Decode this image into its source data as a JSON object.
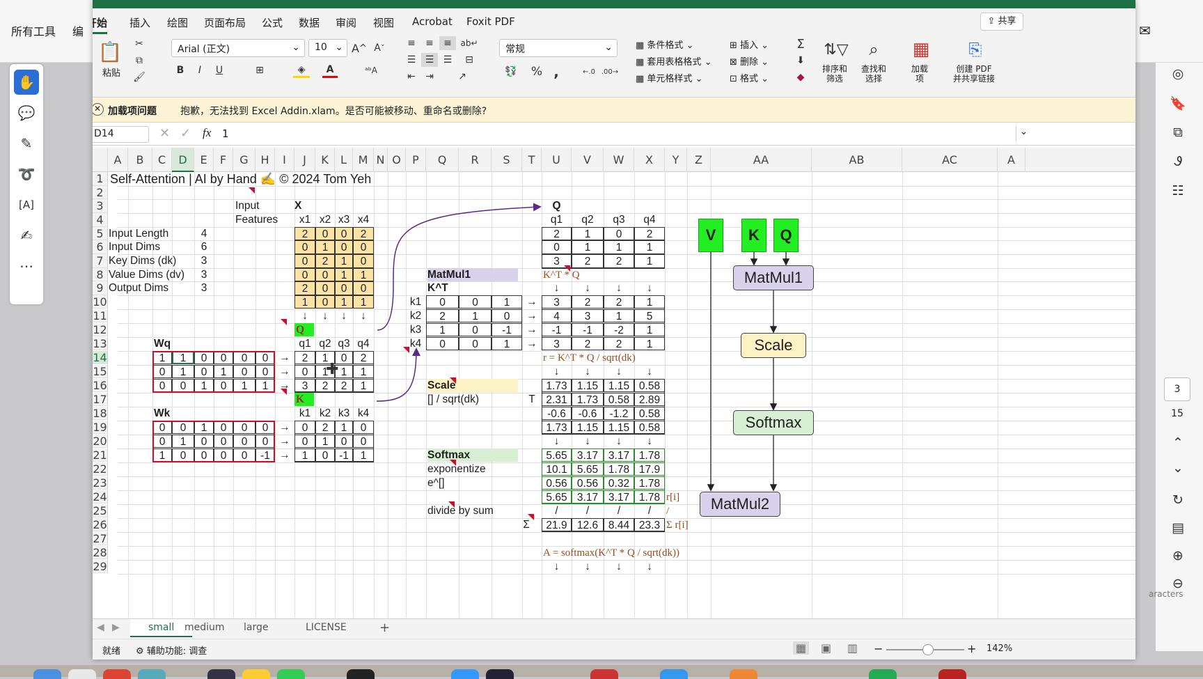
{
  "pdf": {
    "all_tools": "所有工具",
    "edit": "编",
    "page_current": "3",
    "page_total": "15",
    "chars_text": "aracters"
  },
  "tabs": [
    "开始",
    "插入",
    "绘图",
    "页面布局",
    "公式",
    "数据",
    "审阅",
    "视图",
    "Acrobat",
    "Foxit PDF"
  ],
  "share": "共享",
  "ribbon": {
    "paste": "粘贴",
    "font": "Arial (正文)",
    "size": "10",
    "bold": "B",
    "italic": "I",
    "underline": "U",
    "num_format": "常规",
    "cond_fmt": "条件格式",
    "table_fmt": "套用表格格式",
    "cell_style": "单元格样式",
    "insert": "插入",
    "delete": "删除",
    "format": "格式",
    "sort1": "排序和",
    "sort2": "筛选",
    "find1": "查找和",
    "find2": "选择",
    "addins1": "加载",
    "addins2": "项",
    "pdf1": "创建 PDF",
    "pdf2": "并共享链接",
    "percent": "%",
    "comma": ","
  },
  "msg": {
    "title": "加载项问题",
    "text": "抱歉，无法找到 Excel Addin.xlam。是否可能被移动、重命名或删除?"
  },
  "formula": {
    "cell": "D14",
    "fx": "fx",
    "value": "1"
  },
  "cols": [
    "A",
    "B",
    "C",
    "D",
    "E",
    "F",
    "G",
    "H",
    "I",
    "J",
    "K",
    "L",
    "M",
    "N",
    "O",
    "P",
    "Q",
    "R",
    "S",
    "T",
    "U",
    "V",
    "W",
    "X",
    "Y",
    "Z",
    "AA",
    "AB",
    "AC",
    "A"
  ],
  "rows": [
    "1",
    "2",
    "3",
    "4",
    "5",
    "6",
    "7",
    "8",
    "9",
    "10",
    "11",
    "12",
    "13",
    "14",
    "15",
    "16",
    "17",
    "18",
    "19",
    "20",
    "21",
    "22",
    "23",
    "24",
    "25",
    "26",
    "27",
    "28",
    "29"
  ],
  "sheet": {
    "title": "Self-Attention | AI by Hand ✍ © 2024 Tom Yeh",
    "params": [
      [
        "Input Length",
        "4"
      ],
      [
        "Input Dims",
        "6"
      ],
      [
        "Key Dims (dk)",
        "3"
      ],
      [
        "Value Dims (dv)",
        "3"
      ],
      [
        "Output Dims",
        "3"
      ]
    ],
    "input_label1": "Input",
    "input_label2": "Features",
    "x_label": "X",
    "x_heads": [
      "x1",
      "x2",
      "x3",
      "x4"
    ],
    "x": [
      [
        "2",
        "0",
        "0",
        "2"
      ],
      [
        "0",
        "1",
        "0",
        "0"
      ],
      [
        "0",
        "2",
        "1",
        "0"
      ],
      [
        "0",
        "0",
        "1",
        "1"
      ],
      [
        "2",
        "0",
        "0",
        "0"
      ],
      [
        "1",
        "0",
        "1",
        "1"
      ]
    ],
    "arrow_down": "↓",
    "arrow_right": "→",
    "q_tag": "Q",
    "k_tag": "K",
    "wq_label": "Wq",
    "wk_label": "Wk",
    "wq": [
      [
        "1",
        "1",
        "0",
        "0",
        "0",
        "0"
      ],
      [
        "0",
        "1",
        "0",
        "1",
        "0",
        "0"
      ],
      [
        "0",
        "0",
        "1",
        "0",
        "1",
        "1"
      ]
    ],
    "wk": [
      [
        "0",
        "0",
        "1",
        "0",
        "0",
        "0"
      ],
      [
        "0",
        "1",
        "0",
        "0",
        "0",
        "0"
      ],
      [
        "1",
        "0",
        "0",
        "0",
        "0",
        "-1"
      ]
    ],
    "q_heads": [
      "q1",
      "q2",
      "q3",
      "q4"
    ],
    "k_heads": [
      "k1",
      "k2",
      "k3",
      "k4"
    ],
    "qmat": [
      [
        "2",
        "1",
        "0",
        "2"
      ],
      [
        "0",
        "1",
        "1",
        "1"
      ],
      [
        "3",
        "2",
        "2",
        "1"
      ]
    ],
    "kmat": [
      [
        "0",
        "2",
        "1",
        "0"
      ],
      [
        "0",
        "1",
        "0",
        "0"
      ],
      [
        "1",
        "0",
        "-1",
        "1"
      ]
    ],
    "t_label": "T",
    "matmul1": "MatMul1",
    "kt_label": "K^T",
    "kt_rows": [
      "k1",
      "k2",
      "k3",
      "k4"
    ],
    "kt": [
      [
        "0",
        "0",
        "1"
      ],
      [
        "2",
        "1",
        "0"
      ],
      [
        "1",
        "0",
        "-1"
      ],
      [
        "0",
        "0",
        "1"
      ]
    ],
    "qtop_label": "Q",
    "ktq_label": "K^T * Q",
    "ktq": [
      [
        "3",
        "2",
        "2",
        "1"
      ],
      [
        "4",
        "3",
        "1",
        "5"
      ],
      [
        "-1",
        "-1",
        "-2",
        "1"
      ],
      [
        "3",
        "2",
        "2",
        "1"
      ]
    ],
    "r_formula": "r = K^T * Q / sqrt(dk)",
    "scale_label": "Scale",
    "scale_sub": "[] / sqrt(dk)",
    "scaled": [
      [
        "1.73",
        "1.15",
        "1.15",
        "0.58"
      ],
      [
        "2.31",
        "1.73",
        "0.58",
        "2.89"
      ],
      [
        "-0.6",
        "-0.6",
        "-1.2",
        "0.58"
      ],
      [
        "1.73",
        "1.15",
        "1.15",
        "0.58"
      ]
    ],
    "softmax_label": "Softmax",
    "exp_label": "exponentize",
    "exp_sub": "e^[]",
    "expv": [
      [
        "5.65",
        "3.17",
        "3.17",
        "1.78"
      ],
      [
        "10.1",
        "5.65",
        "1.78",
        "17.9"
      ],
      [
        "0.56",
        "0.56",
        "0.32",
        "1.78"
      ],
      [
        "5.65",
        "3.17",
        "3.17",
        "1.78"
      ]
    ],
    "ri_label": "r[i]",
    "div_label": "divide by sum",
    "slash": "/",
    "sigma": "Σ",
    "sums": [
      "21.9",
      "12.6",
      "8.44",
      "23.3"
    ],
    "sum_label": "Σ r[i]",
    "a_formula": "A = softmax(K^T * Q / sqrt(dk))"
  },
  "diagram": {
    "v": "V",
    "k": "K",
    "q": "Q",
    "matmul1": "MatMul1",
    "scale": "Scale",
    "softmax": "Softmax",
    "matmul2": "MatMul2",
    "colors": {
      "matmul": "#d9d2ec",
      "scale": "#fdf2c4",
      "softmax": "#d7efd3",
      "green": "#22ee22"
    }
  },
  "sheet_tabs": [
    "small",
    "medium",
    "large",
    "LICENSE"
  ],
  "status": {
    "ready": "就绪",
    "access": "辅助功能: 调查",
    "zoom": "142%"
  }
}
